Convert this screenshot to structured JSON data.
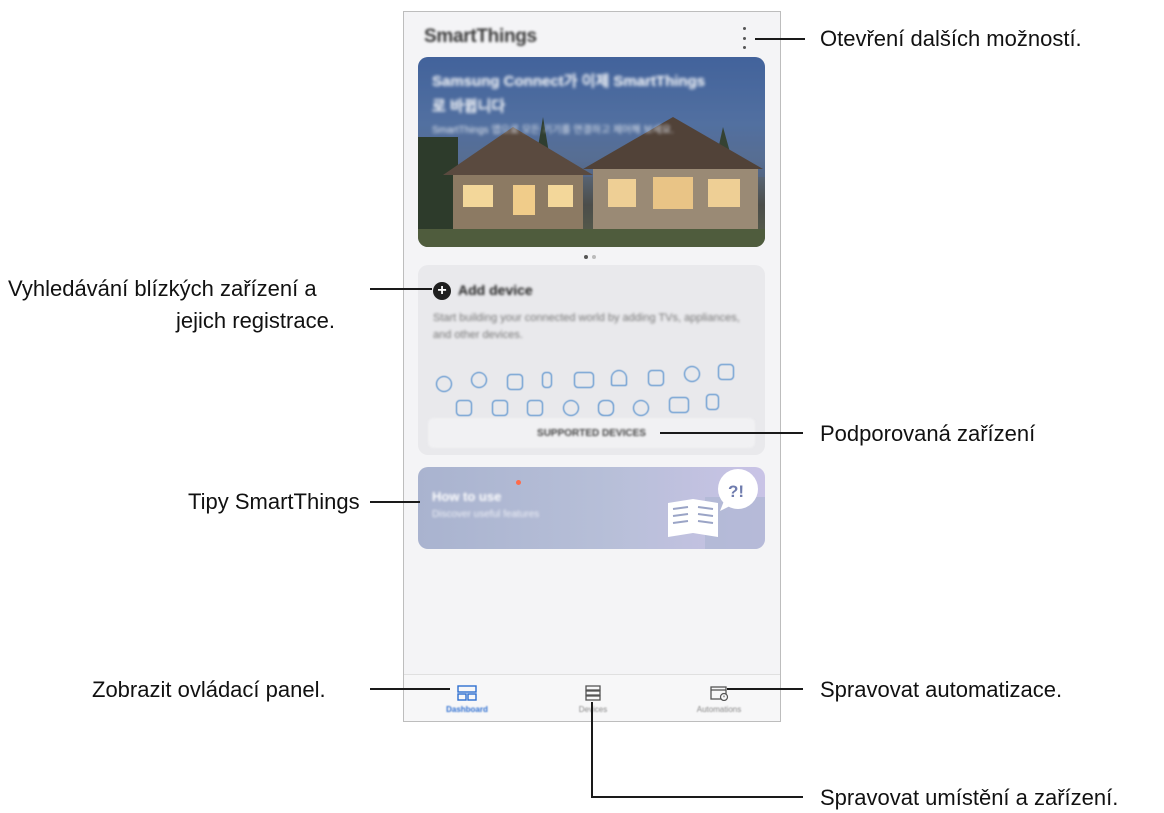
{
  "app": {
    "title": "SmartThings",
    "banner_title_1": "Samsung Connect가 이제 SmartThings",
    "banner_title_2": "로 바뀝니다",
    "banner_sub": "SmartThings 앱으로 모든 기기를 연결하고 제어해 보세요."
  },
  "add_device": {
    "title": "Add device",
    "description": "Start building your connected world by adding TVs, appliances, and other devices.",
    "supported_button": "SUPPORTED DEVICES"
  },
  "tips": {
    "title": "How to use",
    "subtitle": "Discover useful features",
    "badge": "?!"
  },
  "nav": {
    "tabs": [
      {
        "label": "Dashboard",
        "icon": "dashboard-icon",
        "active": true
      },
      {
        "label": "Devices",
        "icon": "devices-icon",
        "active": false
      },
      {
        "label": "Automations",
        "icon": "automations-icon",
        "active": false
      }
    ]
  },
  "callouts": {
    "more_options": "Otevření dalších možností.",
    "find_devices_1": "Vyhledávání blízkých zařízení a",
    "find_devices_2": "jejich registrace.",
    "supported_devices": "Podporovaná zařízení",
    "tips": "Tipy SmartThings",
    "dashboard": "Zobrazit ovládací panel.",
    "automations": "Spravovat automatizace.",
    "locations_devices": "Spravovat umístění a zařízení."
  },
  "colors": {
    "accent": "#2f6fd0",
    "icon_blue": "#3c80c8",
    "tip_badge": "#ff6b4a"
  }
}
